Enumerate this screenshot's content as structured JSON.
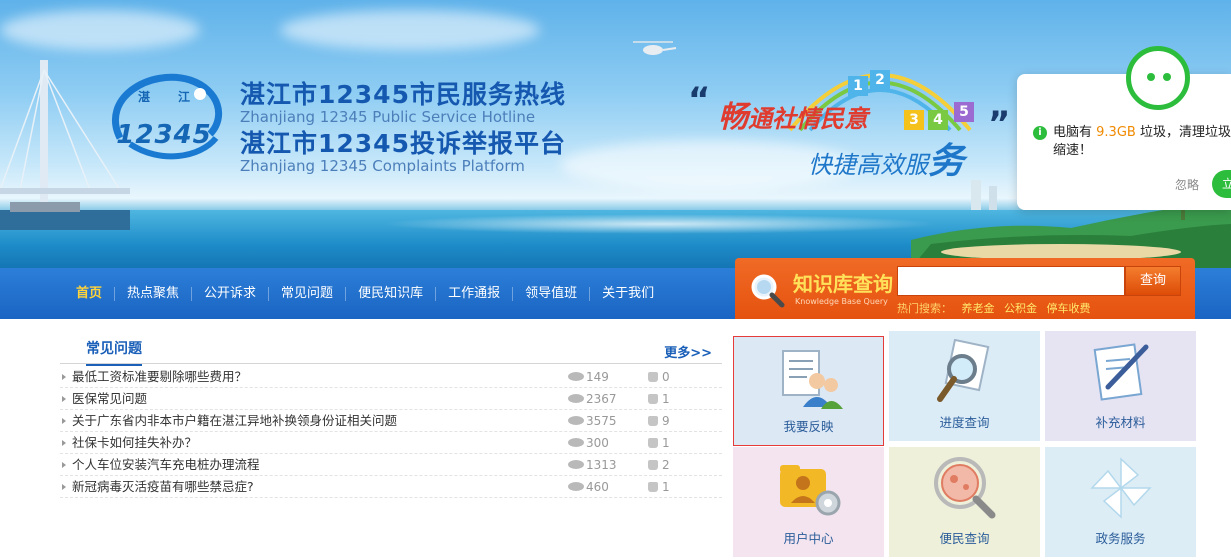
{
  "header": {
    "logo_number": "12345",
    "logo_char_left": "湛",
    "logo_char_right": "江",
    "title_cn_1": "湛江市12345市民服务热线",
    "title_en_1": "Zhanjiang 12345 Public Service Hotline",
    "title_cn_2": "湛江市12345投诉举报平台",
    "title_en_2": "Zhanjiang 12345 Complaints Platform",
    "slogan_open_quote": "“",
    "slogan_close_quote": "”",
    "slogan_line1_big": "畅",
    "slogan_line1_rest": "通社情民意",
    "slogan_line2_rest": "快捷高效服",
    "slogan_line2_big": "务",
    "slogan_numbers": [
      "1",
      "2",
      "3",
      "4",
      "5"
    ]
  },
  "popup": {
    "message_prefix": "电脑有 ",
    "message_amount": "9.3GB",
    "message_suffix": " 垃圾，清理垃圾缩速！",
    "ignore_label": "忽略",
    "action_label": "立"
  },
  "nav": {
    "items": [
      "首页",
      "热点聚焦",
      "公开诉求",
      "常见问题",
      "便民知识库",
      "工作通报",
      "领导值班",
      "关于我们"
    ]
  },
  "knowledge_search": {
    "title": "知识库查询",
    "subtitle": "Knowledge Base Query",
    "input_value": "",
    "button_label": "查询",
    "hot_label": "热门搜索：",
    "hot_terms": [
      "养老金",
      "公积金",
      "停车收费"
    ]
  },
  "faq": {
    "title": "常见问题",
    "more_label": "更多>>",
    "rows": [
      {
        "question": "最低工资标准要剔除哪些费用？",
        "views": "149",
        "likes": "0"
      },
      {
        "question": "医保常见问题",
        "views": "2367",
        "likes": "1"
      },
      {
        "question": "关于广东省内非本市户籍在湛江异地补换领身份证相关问题",
        "views": "3575",
        "likes": "9"
      },
      {
        "question": "社保卡如何挂失补办？",
        "views": "300",
        "likes": "1"
      },
      {
        "question": "个人车位安装汽车充电桩办理流程",
        "views": "1313",
        "likes": "2"
      },
      {
        "question": "新冠病毒灭活疫苗有哪些禁忌症?",
        "views": "460",
        "likes": "1"
      }
    ]
  },
  "tiles": [
    {
      "label": "我要反映",
      "bg": "#dde8f5",
      "selected": true
    },
    {
      "label": "进度查询",
      "bg": "#dcecf7"
    },
    {
      "label": "补充材料",
      "bg": "#e6e3f3"
    },
    {
      "label": "用户中心",
      "bg": "#f3e4ef"
    },
    {
      "label": "便民查询",
      "bg": "#eef0da"
    },
    {
      "label": "政务服务",
      "bg": "#dcedf6"
    }
  ],
  "colors": {
    "nav_blue": "#1a64c3",
    "kb_orange": "#e5520f",
    "popup_green": "#2dbd3c",
    "link_blue": "#1a5fb8"
  }
}
